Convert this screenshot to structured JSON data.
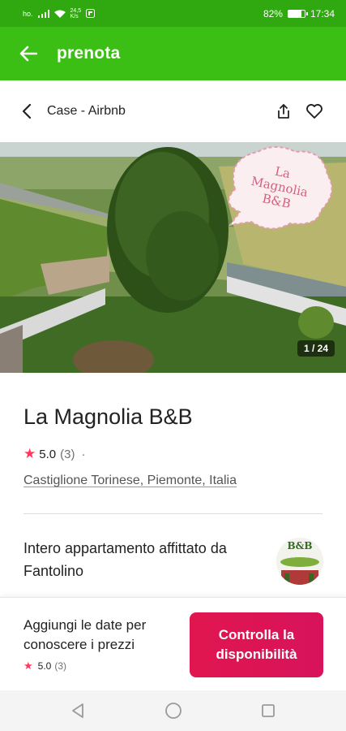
{
  "status_bar": {
    "carrier": "ho.",
    "speed_value": "24,5",
    "speed_unit": "K/s",
    "battery": "82%",
    "battery_level": 0.82,
    "time": "17:34"
  },
  "app_bar": {
    "title": "prenota",
    "color": "#3bbf14"
  },
  "header": {
    "breadcrumb": "Case - Airbnb"
  },
  "gallery": {
    "counter": "1 / 24",
    "sign_line1": "La",
    "sign_line2": "Magnolia",
    "sign_line3": "B&B"
  },
  "listing": {
    "title": "La Magnolia B&B",
    "rating": "5.0",
    "reviews": "(3)",
    "separator": "·",
    "location": "Castiglione Torinese, Piemonte, Italia",
    "host_text": "Intero appartamento affittato da Fantolino",
    "avatar_label": "B&B"
  },
  "footer": {
    "prompt": "Aggiungi le date per conoscere i prezzi",
    "rating": "5.0",
    "reviews": "(3)",
    "cta_label": "Controlla la disponibilità",
    "cta_color": "#e0164f"
  },
  "icons": {
    "back": "arrow-left-icon",
    "breadcrumb_back": "chevron-left-icon",
    "share": "share-icon",
    "favorite": "heart-icon",
    "star": "star-icon",
    "nav_back": "triangle-back-icon",
    "nav_home": "circle-home-icon",
    "nav_recents": "square-recents-icon"
  }
}
